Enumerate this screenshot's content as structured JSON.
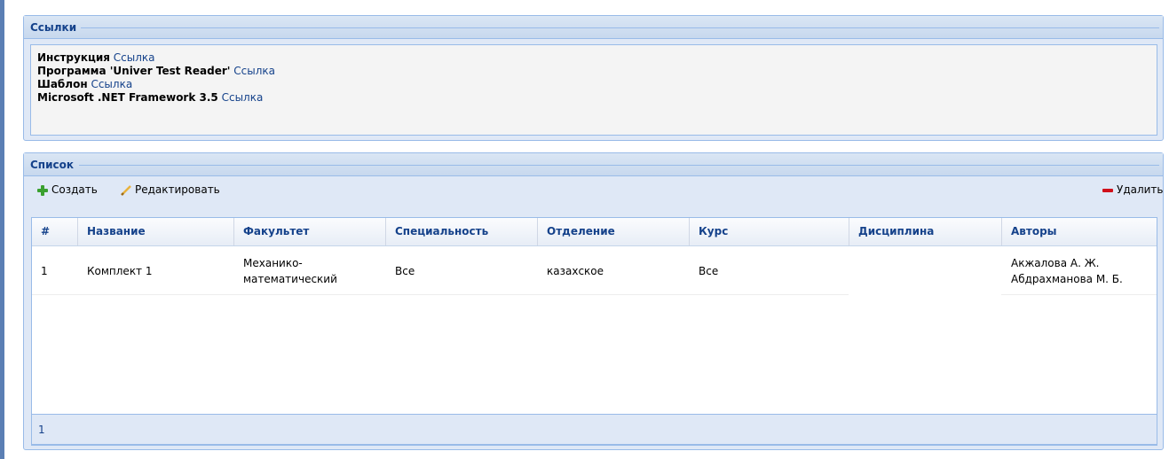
{
  "links_panel": {
    "title": "Ссылки",
    "items": [
      {
        "label": "Инструкция",
        "link": "Ссылка"
      },
      {
        "label": "Программа 'Univer Test Reader'",
        "link": "Ссылка"
      },
      {
        "label": "Шаблон",
        "link": "Ссылка"
      },
      {
        "label": "Microsoft .NET Framework 3.5",
        "link": "Ссылка"
      }
    ]
  },
  "list_panel": {
    "title": "Список",
    "toolbar": {
      "create_label": "Создать",
      "edit_label": "Редактировать",
      "delete_label": "Удалить"
    },
    "columns": [
      "#",
      "Название",
      "Факультет",
      "Специальность",
      "Отделение",
      "Курс",
      "Дисциплина",
      "Авторы"
    ],
    "rows": [
      {
        "num": "1",
        "name": "Комплект 1",
        "faculty_line1": "Механико-",
        "faculty_line2": "математический",
        "specialty": "Все",
        "department": "казахское",
        "course": "Все",
        "discipline": "",
        "author1": "Акжалова А. Ж.",
        "author2": "Абдрахманова М. Б."
      }
    ],
    "pager": {
      "page": "1"
    }
  },
  "colors": {
    "accent": "#15428b",
    "border": "#99bbe8",
    "panel_bg": "#dfe8f6",
    "add": "#3aa02f",
    "delete": "#d0101a"
  }
}
